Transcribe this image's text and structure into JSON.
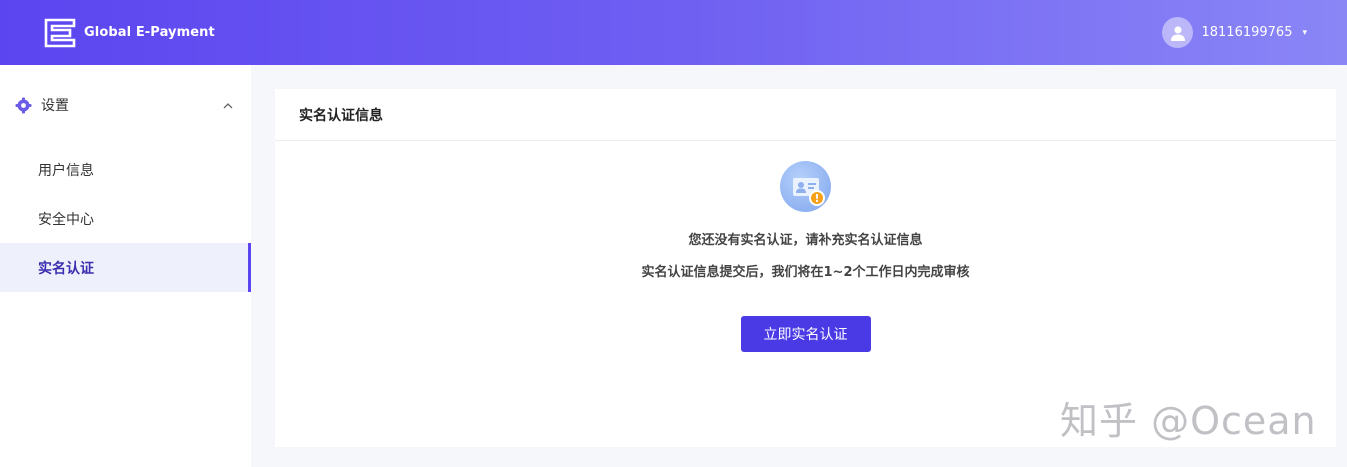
{
  "header": {
    "brand_name": "Global E-Payment",
    "username": "18116199765",
    "caret": "▾"
  },
  "sidebar": {
    "group_label": "设置",
    "group_chevron": "^",
    "items": [
      {
        "label": "用户信息"
      },
      {
        "label": "安全中心"
      },
      {
        "label": "实名认证"
      }
    ]
  },
  "card": {
    "title": "实名认证信息",
    "message_line1": "您还没有实名认证，请补充实名认证信息",
    "message_line2": "实名认证信息提交后，我们将在1~2个工作日内完成审核",
    "button_label": "立即实名认证",
    "warn_mark": "!"
  },
  "watermark": "知乎 @Ocean",
  "colors": {
    "accent": "#4a3ae6",
    "header_start": "#5b45f0",
    "header_end": "#8a86f6",
    "warning": "#f7a11a"
  }
}
